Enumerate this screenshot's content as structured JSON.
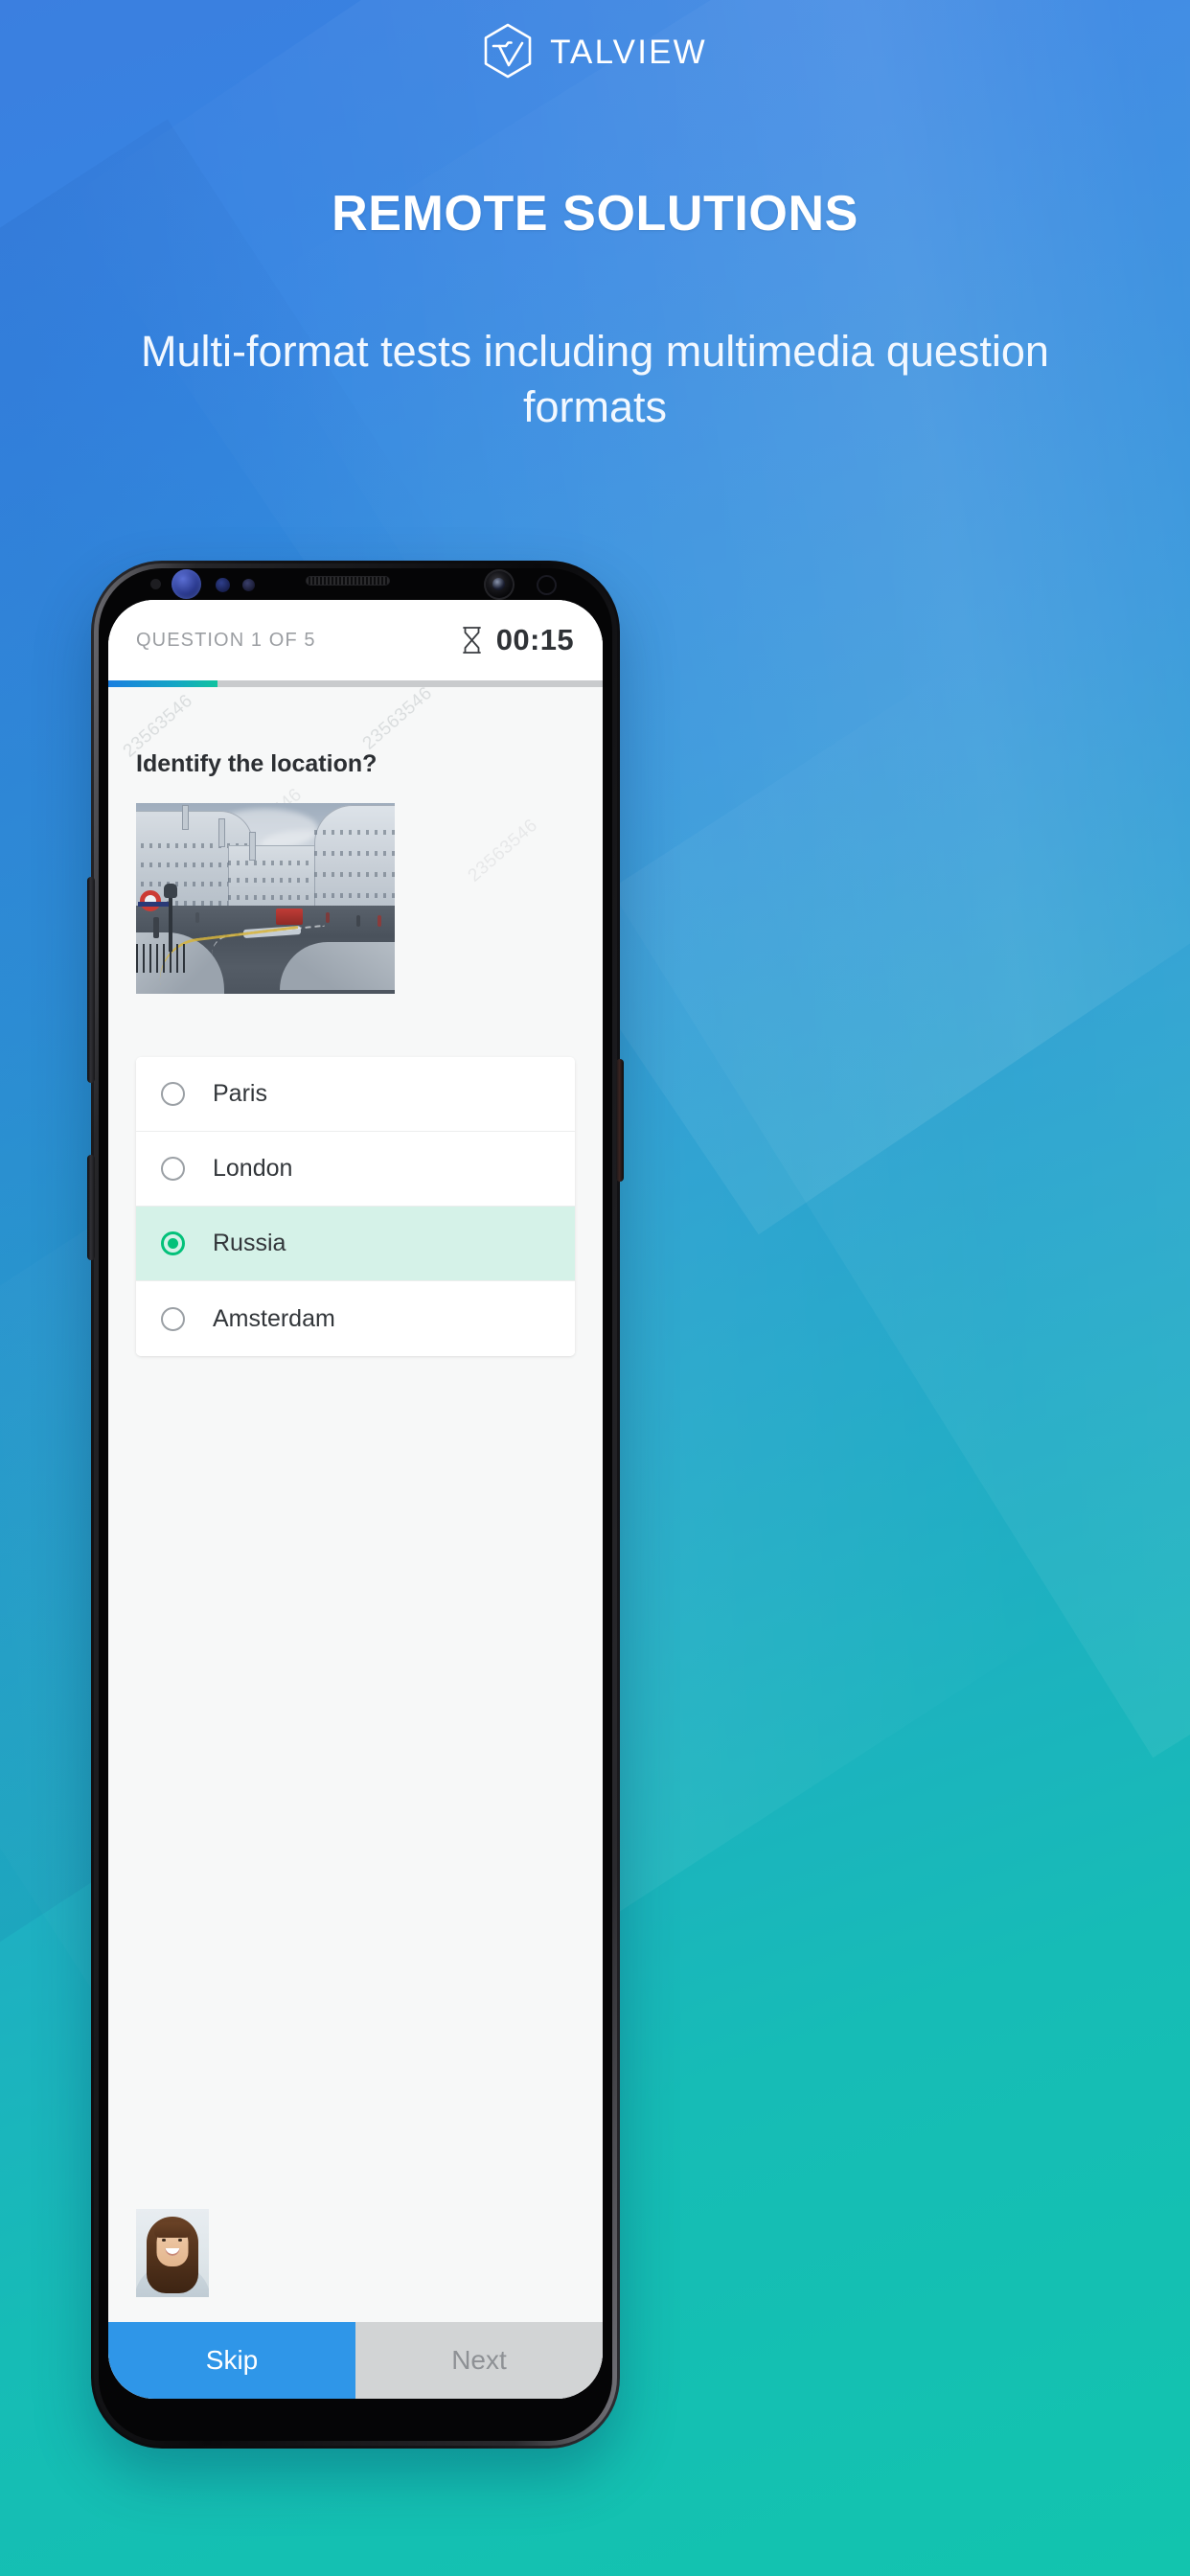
{
  "brand": {
    "name": "TALVIEW",
    "logo_icon": "talview-hexagon-v-logo",
    "headline": "REMOTE SOLUTIONS",
    "subhead": "Multi-format tests including multimedia question formats",
    "colors": {
      "gradient_start": "#3b7fe0",
      "gradient_end": "#12c4ae",
      "text": "#ffffff"
    }
  },
  "device": {
    "type": "smartphone-mockup",
    "sensors": [
      "proximity-sensor",
      "iris-scanner",
      "ir-sensor",
      "light-sensor",
      "earpiece-speaker",
      "front-camera",
      "flood-illuminator"
    ],
    "buttons": [
      "volume-rocker",
      "assistant-button",
      "power-button"
    ]
  },
  "app": {
    "topbar": {
      "question_counter": "QUESTION 1 OF 5",
      "timer_icon": "hourglass-icon",
      "timer": "00:15"
    },
    "progress": {
      "percent": 22,
      "fill_start": "#1a7fe0",
      "fill_end": "#10c39f",
      "track": "#c9cbcd"
    },
    "question": {
      "text": "Identify the location?",
      "media_icon": "street-photo-regent-street-london",
      "media_alt": "Curved street lined with classical stone buildings, London Underground roundel sign and red bus"
    },
    "watermarks": [
      "23563546",
      "23563546",
      "23563546",
      "23563546",
      "23563546",
      "23563546"
    ],
    "options": [
      {
        "label": "Paris",
        "selected": false
      },
      {
        "label": "London",
        "selected": false
      },
      {
        "label": "Russia",
        "selected": true
      },
      {
        "label": "Amsterdam",
        "selected": false
      }
    ],
    "selected_color": "#04c17a",
    "selected_row_bg": "#d5f2e8",
    "proctor": {
      "icon": "webcam-thumbnail",
      "alt": "Live webcam feed of smiling candidate with long brown hair"
    },
    "actions": {
      "skip_label": "Skip",
      "next_label": "Next",
      "skip_color": "#2f96e8",
      "next_color": "#d2d4d5"
    }
  }
}
